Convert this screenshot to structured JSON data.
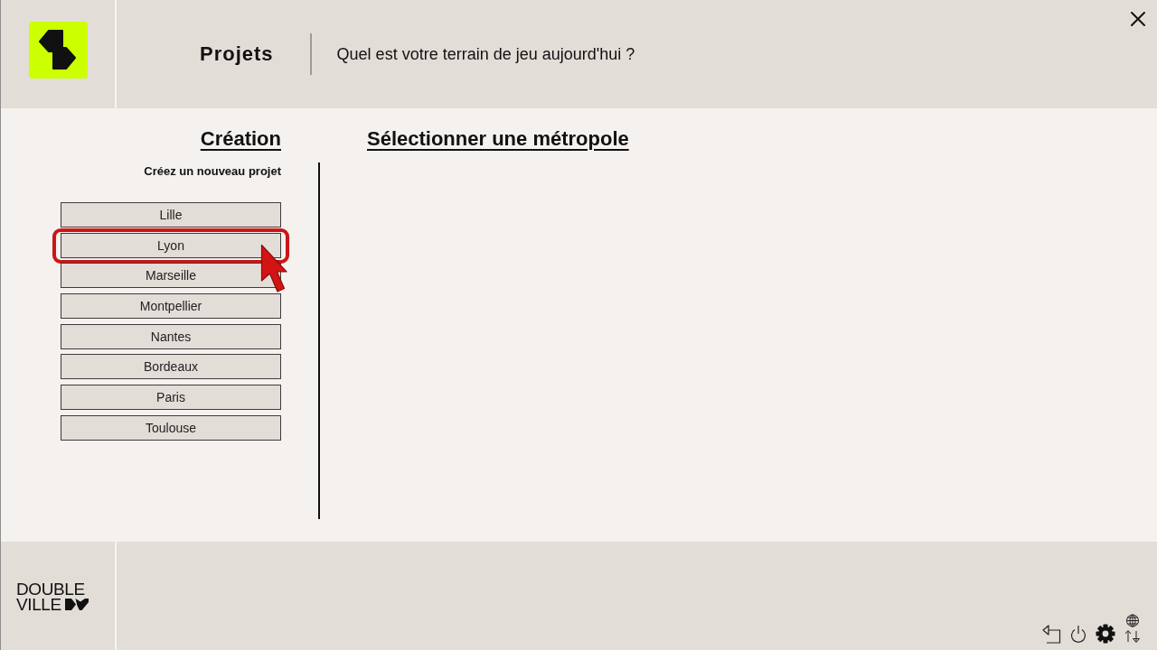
{
  "header": {
    "title": "Projets",
    "prompt": "Quel est votre terrain de jeu aujourd'hui ?"
  },
  "creation": {
    "heading": "Création",
    "subtitle": "Créez un nouveau projet",
    "cities": [
      {
        "label": "Lille",
        "highlighted": false
      },
      {
        "label": "Lyon",
        "highlighted": true
      },
      {
        "label": "Marseille",
        "highlighted": false
      },
      {
        "label": "Montpellier",
        "highlighted": false
      },
      {
        "label": "Nantes",
        "highlighted": false
      },
      {
        "label": "Bordeaux",
        "highlighted": false
      },
      {
        "label": "Paris",
        "highlighted": false
      },
      {
        "label": "Toulouse",
        "highlighted": false
      }
    ]
  },
  "selection": {
    "heading": "Sélectionner une métropole"
  },
  "footer": {
    "brand_lines": [
      "DOUBLE",
      "VILLE"
    ]
  }
}
